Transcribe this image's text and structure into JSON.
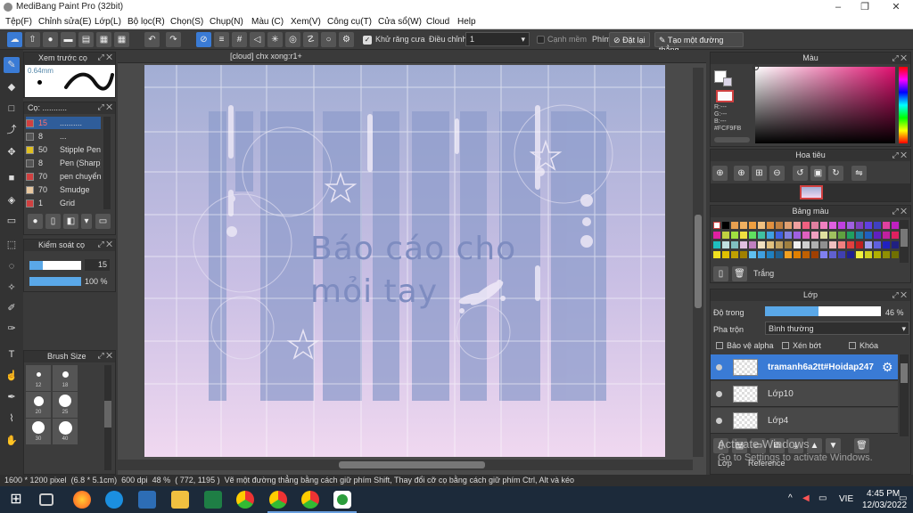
{
  "app": {
    "title": "MediBang Paint Pro (32bit)"
  },
  "menu": [
    "Tệp(F)",
    "Chỉnh sửa(E)",
    "Lớp(L)",
    "Bộ lọc(R)",
    "Chọn(S)",
    "Chụp(N)",
    "Màu (C)",
    "Xem(V)",
    "Công cụ(T)",
    "Cửa sổ(W)",
    "Cloud",
    "Help"
  ],
  "toolbar": {
    "antialias": "Khử răng cưa",
    "adjust_label": "Điều chỉnh",
    "adjust_value": "1",
    "edge_label": "Cạnh mềm",
    "key_label": "Phím",
    "reset": "Đặt lại",
    "straight": "Tạo một đường thẳng"
  },
  "brush_preview": {
    "title": "Xem trước cọ",
    "size": "0.64mm"
  },
  "brush_list": {
    "title": "Cọ: ...........",
    "items": [
      {
        "n": "15",
        "l": "..........",
        "c": "#d04040"
      },
      {
        "n": "8",
        "l": "...",
        "c": "#555555"
      },
      {
        "n": "50",
        "l": "Stipple Pen",
        "c": "#e0c020"
      },
      {
        "n": "8",
        "l": "Pen (Sharp)",
        "c": "#555555"
      },
      {
        "n": "70",
        "l": "pen chuyển",
        "c": "#d04040"
      },
      {
        "n": "70",
        "l": "Smudge",
        "c": "#e8c8a0"
      },
      {
        "n": "1",
        "l": "Grid",
        "c": "#d04040"
      }
    ]
  },
  "brush_control": {
    "title": "Kiểm soát cọ",
    "size": "15",
    "opacity": "100 %"
  },
  "brush_size": {
    "title": "Brush Size",
    "sizes": [
      "12",
      "18",
      "20",
      "25",
      "30",
      "40"
    ]
  },
  "doc": {
    "tab": "[cloud] chx xong:r1+",
    "line1": "Báo cáo cho",
    "line2": "mỏi tay"
  },
  "color_panel": {
    "title": "Màu",
    "r": "R:---",
    "g": "G:---",
    "b": "B:---",
    "hex": "#FCF9FB"
  },
  "navigator": {
    "title": "Hoa tiêu"
  },
  "palette": {
    "title": "Bảng màu",
    "name": "Trắng"
  },
  "layers": {
    "title": "Lớp",
    "opacity_label": "Độ trong",
    "opacity": "46 %",
    "blend_label": "Pha trộn",
    "blend": "Bình thường",
    "protect": "Bảo vệ alpha",
    "clip": "Xén bớt",
    "lock": "Khóa",
    "items": [
      "tramanh6a2tt#Hoidap247",
      "Lớp10",
      "Lớp4"
    ],
    "tab1": "Lớp",
    "tab2": "Reference"
  },
  "watermark": {
    "l1": "Activate Windows",
    "l2": "Go to Settings to activate Windows."
  },
  "status": {
    "dims": "1600 * 1200 pixel",
    "cm": "(6.8 * 5.1cm)",
    "dpi": "600 dpi",
    "zoom": "48 %",
    "coords": "( 772, 1195 )",
    "hint": "Vẽ một đường thẳng bằng cách giữ phím Shift, Thay đổi cỡ cọ bằng cách giữ phím Ctrl, Alt và kéo"
  },
  "taskbar": {
    "lang": "VIE",
    "time": "4:45 PM",
    "date": "12/03/2022"
  }
}
